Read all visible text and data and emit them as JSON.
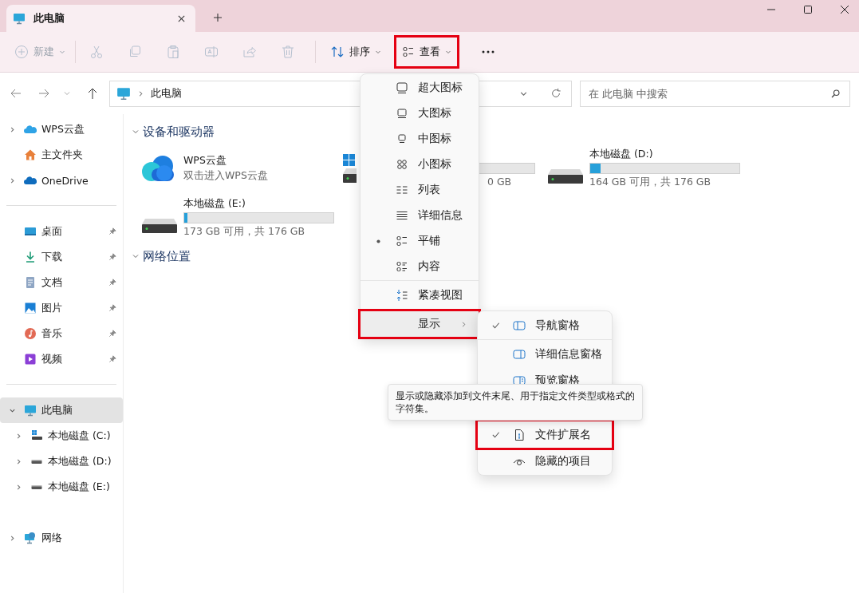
{
  "tabs": [
    {
      "label": "此电脑",
      "selected": true
    }
  ],
  "toolbar": {
    "items": [
      {
        "kind": "new",
        "label": "新建",
        "disabled": true
      },
      {
        "kind": "separator"
      },
      {
        "kind": "cut",
        "disabled": true
      },
      {
        "kind": "copy",
        "disabled": true
      },
      {
        "kind": "paste",
        "disabled": true
      },
      {
        "kind": "rename",
        "disabled": true
      },
      {
        "kind": "share",
        "disabled": true
      },
      {
        "kind": "delete",
        "disabled": true
      },
      {
        "kind": "separator"
      },
      {
        "kind": "sort",
        "label": "排序",
        "disabled": false
      },
      {
        "kind": "view",
        "label": "查看",
        "disabled": false,
        "highlighted": true
      },
      {
        "kind": "more",
        "disabled": false
      }
    ]
  },
  "address_bar": {
    "path": "此电脑"
  },
  "search": {
    "placeholder": "在 此电脑 中搜索"
  },
  "sidebar": {
    "groups": [
      {
        "items": [
          {
            "kind": "wps",
            "label": "WPS云盘",
            "expanded": false,
            "selected": false
          },
          {
            "kind": "home",
            "label": "主文件夹",
            "selected": false
          },
          {
            "kind": "onedrive",
            "label": "OneDrive",
            "expanded": false,
            "selected": false
          }
        ]
      },
      {
        "separator": true,
        "items": [
          {
            "kind": "desktop",
            "label": "桌面",
            "pinned": true,
            "selected": false
          },
          {
            "kind": "download",
            "label": "下载",
            "pinned": true,
            "selected": false
          },
          {
            "kind": "documents",
            "label": "文档",
            "pinned": true,
            "selected": false
          },
          {
            "kind": "pictures",
            "label": "图片",
            "pinned": true,
            "selected": false
          },
          {
            "kind": "music",
            "label": "音乐",
            "pinned": true,
            "selected": false
          },
          {
            "kind": "video",
            "label": "视频",
            "pinned": true,
            "selected": false
          }
        ]
      },
      {
        "separator": true,
        "items": [
          {
            "kind": "pc",
            "label": "此电脑",
            "expanded": true,
            "selected": true,
            "children": [
              {
                "kind": "system-drive",
                "label": "本地磁盘 (C:)",
                "expanded": false,
                "selected": false
              },
              {
                "kind": "drive",
                "label": "本地磁盘 (D:)",
                "expanded": false,
                "selected": false
              },
              {
                "kind": "drive",
                "label": "本地磁盘 (E:)",
                "expanded": false,
                "selected": false
              }
            ]
          }
        ]
      },
      {
        "separator": false,
        "items": [
          {
            "kind": "network",
            "label": "网络",
            "expanded": false,
            "selected": false
          }
        ]
      }
    ]
  },
  "sections": [
    {
      "title": "设备和驱动器",
      "expanded": true,
      "items": [
        {
          "kind": "cloud",
          "name": "WPS云盘",
          "subtitle": "双击进入WPS云盘"
        },
        {
          "kind": "system-drive",
          "usage": "0 GB"
        },
        {
          "kind": "drive",
          "name": "本地磁盘 (D:)",
          "level": 0.07,
          "usage": "164 GB 可用，共 176 GB"
        },
        {
          "kind": "drive",
          "name": "本地磁盘 (E:)",
          "level": 0.02,
          "usage": "173 GB 可用，共 176 GB"
        }
      ]
    },
    {
      "title": "网络位置",
      "expanded": true
    }
  ],
  "view_menu": {
    "groups": [
      [
        {
          "kind": "extra-large",
          "label": "超大图标",
          "selected": false
        },
        {
          "kind": "large",
          "label": "大图标",
          "selected": false
        },
        {
          "kind": "medium",
          "label": "中图标",
          "selected": false
        },
        {
          "kind": "small",
          "label": "小图标",
          "selected": false
        },
        {
          "kind": "list",
          "label": "列表",
          "selected": false
        },
        {
          "kind": "details",
          "label": "详细信息",
          "selected": false
        },
        {
          "kind": "tiles",
          "label": "平铺",
          "selected": true
        },
        {
          "kind": "content",
          "label": "内容",
          "selected": false
        }
      ],
      [
        {
          "kind": "compact",
          "label": "紧凑视图",
          "checked": false
        },
        {
          "kind": "show",
          "label": "显示",
          "submenu": true,
          "hovered": true,
          "highlighted": true
        }
      ]
    ]
  },
  "show_submenu": {
    "groups": [
      [
        {
          "kind": "nav-pane",
          "label": "导航窗格",
          "checked": true,
          "highlighted": false
        }
      ],
      [
        {
          "kind": "details-pane",
          "label": "详细信息窗格",
          "checked": false,
          "highlighted": false
        },
        {
          "kind": "preview-pane",
          "label": "预览窗格",
          "checked": false,
          "highlighted": false
        },
        {
          "kind": "extensions",
          "label": "文件扩展名",
          "checked": true,
          "highlighted": true
        },
        {
          "kind": "hidden",
          "label": "隐藏的项目",
          "checked": false,
          "highlighted": false
        }
      ]
    ]
  },
  "tooltip": {
    "text": "显示或隐藏添加到文件末尾、用于指定文件类型或格式的字符集。"
  }
}
